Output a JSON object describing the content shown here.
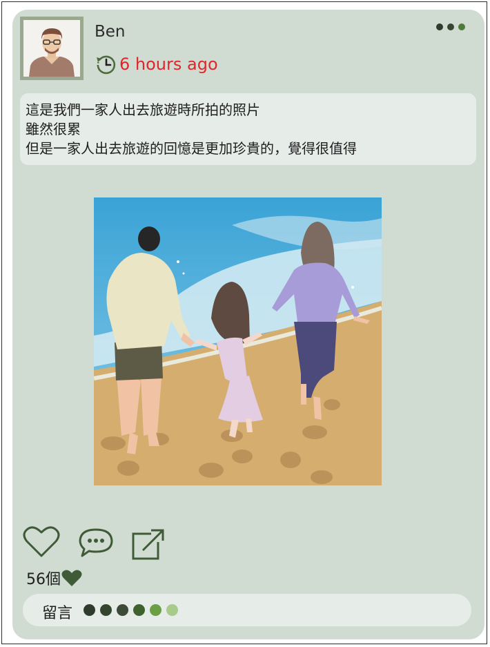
{
  "post": {
    "author": "Ben",
    "time_ago": "6 hours ago",
    "caption_lines": [
      "這是我們一家人出去旅遊時所拍的照片",
      "雖然很累",
      "但是一家人出去旅遊的回憶是更加珍貴的，覺得很值得"
    ],
    "likes_count": "56個",
    "comment_label": "留言"
  },
  "icons": {
    "avatar": "avatar-man-glasses",
    "clock": "clock-history-icon",
    "more": "more-dots-icon",
    "like": "heart-outline-icon",
    "comment": "speech-bubble-icon",
    "share": "share-external-icon",
    "liked": "heart-filled-icon"
  },
  "colors": {
    "card_bg": "#d0dcd1",
    "time_red": "#e0262b",
    "icon_green": "#3f5a36",
    "caption_bg": "#e6ece8"
  },
  "comment_dots": [
    "#2f3b2c",
    "#34452f",
    "#3b4b37",
    "#3e6130",
    "#6aa043",
    "#a6cb8b"
  ]
}
